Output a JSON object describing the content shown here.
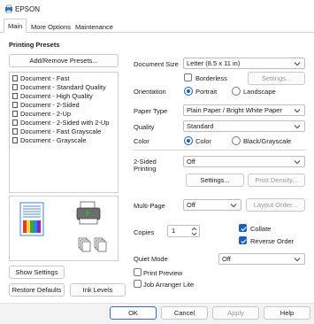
{
  "window": {
    "title": "EPSON"
  },
  "tabs": [
    {
      "label": "Main",
      "active": true
    },
    {
      "label": "More Options",
      "active": false
    },
    {
      "label": "Maintenance",
      "active": false
    }
  ],
  "presets": {
    "heading": "Printing Presets",
    "add_remove_label": "Add/Remove Presets...",
    "items": [
      "Document - Fast",
      "Document - Standard Quality",
      "Document - High Quality",
      "Document - 2-Sided",
      "Document - 2-Up",
      "Document - 2-Sided with 2-Up",
      "Document - Fast Grayscale",
      "Document - Grayscale"
    ],
    "show_settings_label": "Show Settings",
    "restore_defaults_label": "Restore Defaults",
    "ink_levels_label": "Ink Levels"
  },
  "settings": {
    "document_size": {
      "label": "Document Size",
      "value": "Letter (8.5 x 11 in)"
    },
    "borderless": {
      "label": "Borderless",
      "checked": false,
      "settings_label": "Settings..."
    },
    "orientation": {
      "label": "Orientation",
      "options": [
        "Portrait",
        "Landscape"
      ],
      "selected": "Portrait"
    },
    "paper_type": {
      "label": "Paper Type",
      "value": "Plain Paper / Bright White Paper"
    },
    "quality": {
      "label": "Quality",
      "value": "Standard"
    },
    "color": {
      "label": "Color",
      "options": [
        "Color",
        "Black/Grayscale"
      ],
      "selected": "Color"
    },
    "two_sided": {
      "label_line1": "2-Sided",
      "label_line2": "Printing",
      "value": "Off",
      "settings_label": "Settings...",
      "print_density_label": "Print Density..."
    },
    "multi_page": {
      "label": "Multi-Page",
      "value": "Off",
      "layout_order_label": "Layout Order..."
    },
    "copies": {
      "label": "Copies",
      "value": "1"
    },
    "collate": {
      "label": "Collate",
      "checked": true
    },
    "reverse_order": {
      "label": "Reverse Order",
      "checked": true
    },
    "quiet_mode": {
      "label": "Quiet Mode",
      "value": "Off"
    },
    "print_preview": {
      "label": "Print Preview",
      "checked": false
    },
    "job_arranger": {
      "label": "Job Arranger Lite",
      "checked": false
    }
  },
  "footer": {
    "ok_label": "OK",
    "cancel_label": "Cancel",
    "apply_label": "Apply",
    "help_label": "Help"
  },
  "colors": {
    "accent": "#1a5fb4",
    "border": "#cfcfcf"
  }
}
